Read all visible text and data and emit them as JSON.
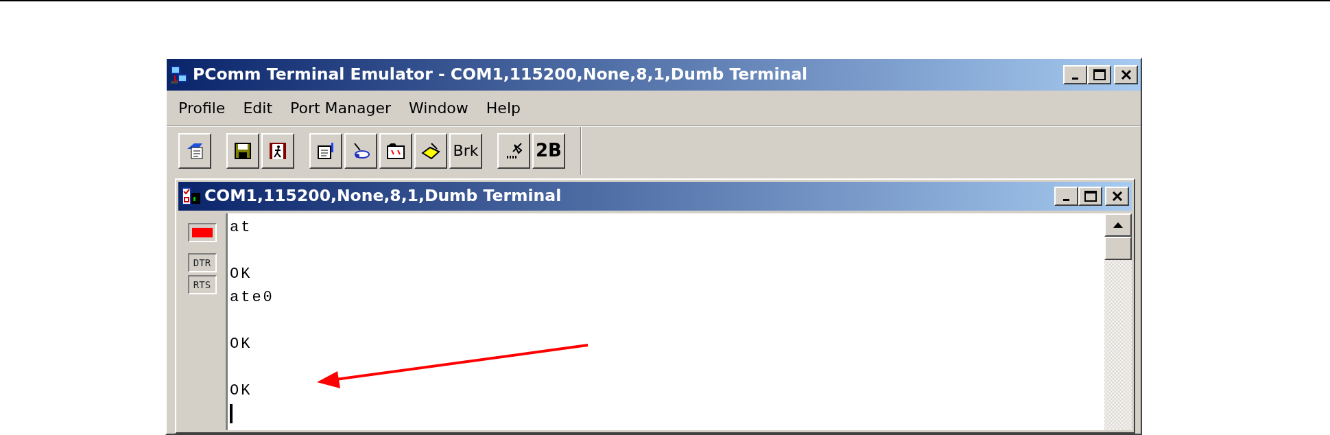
{
  "window": {
    "title": "PComm Terminal Emulator - COM1,115200,None,8,1,Dumb Terminal"
  },
  "menu": [
    "Profile",
    "Edit",
    "Port Manager",
    "Window",
    "Help"
  ],
  "toolbar": [
    {
      "buttons": [
        {
          "kind": "icon"
        }
      ]
    },
    {
      "buttons": [
        {
          "kind": "icon"
        },
        {
          "kind": "icon"
        }
      ]
    },
    {
      "buttons": [
        {
          "kind": "icon"
        },
        {
          "kind": "icon"
        },
        {
          "kind": "icon"
        },
        {
          "kind": "icon"
        },
        {
          "kind": "label",
          "label": "Brk"
        }
      ]
    },
    {
      "buttons": [
        {
          "kind": "icon"
        },
        {
          "kind": "label",
          "label": "2B"
        }
      ]
    }
  ],
  "child_window": {
    "title": "COM1,115200,None,8,1,Dumb Terminal",
    "status_lamp": {
      "color": "#ff0000"
    },
    "signals": [
      {
        "label": "DTR"
      },
      {
        "label": "RTS"
      }
    ],
    "terminal": [
      {
        "kind": "text",
        "text": "at"
      },
      {
        "kind": "blank"
      },
      {
        "kind": "text",
        "text": "OK"
      },
      {
        "kind": "text",
        "text": "ate0"
      },
      {
        "kind": "blank"
      },
      {
        "kind": "text",
        "text": "OK"
      },
      {
        "kind": "blank"
      },
      {
        "kind": "text",
        "text": "OK"
      },
      {
        "kind": "cursor"
      }
    ]
  }
}
